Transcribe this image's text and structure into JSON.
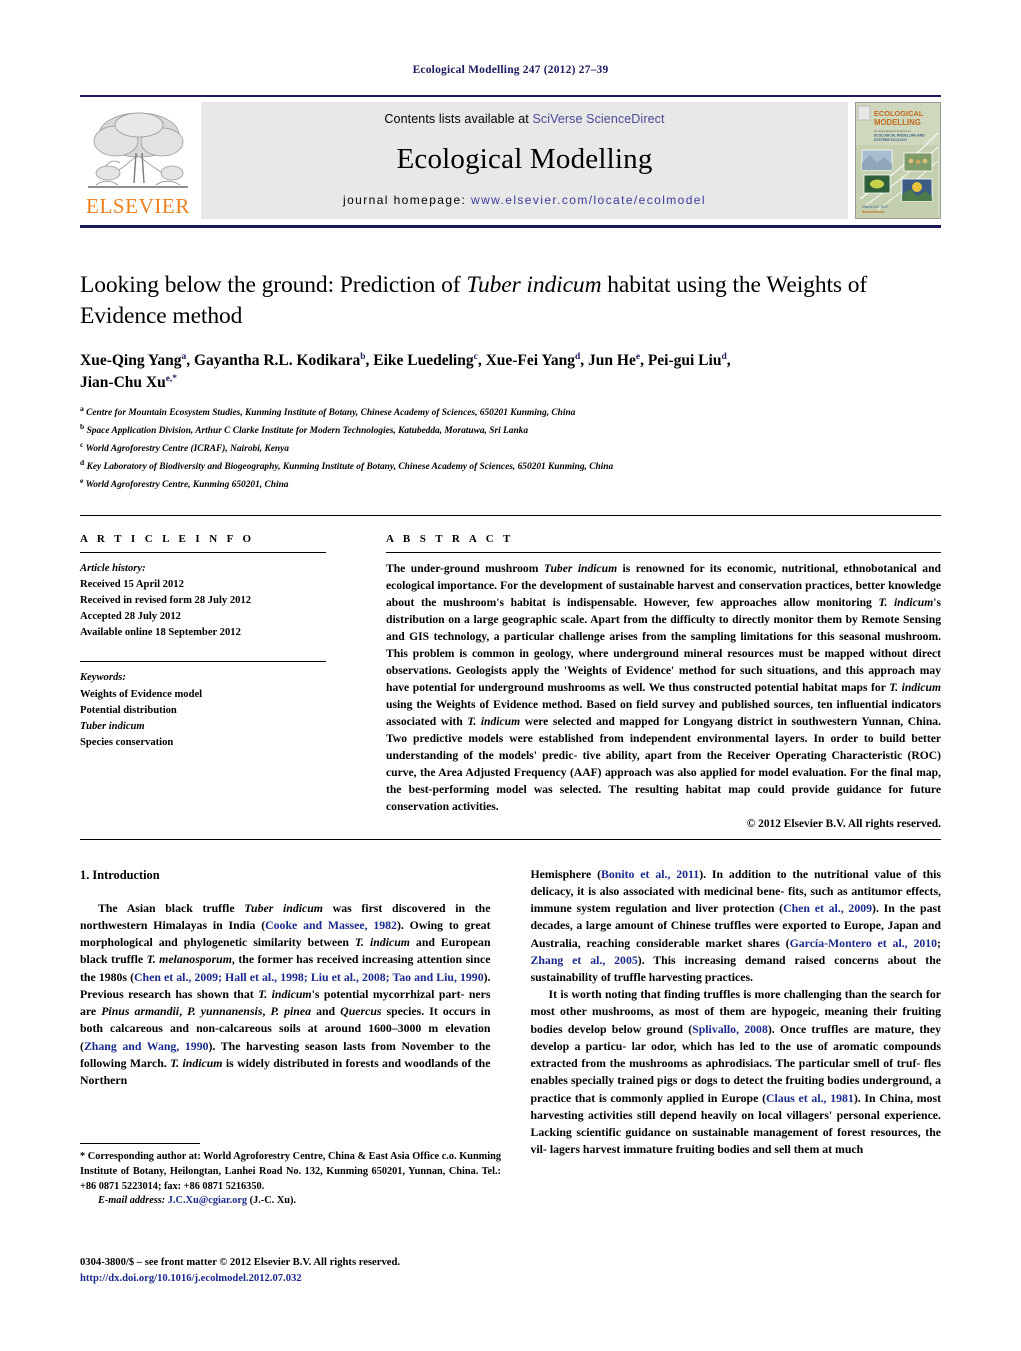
{
  "running_head": "Ecological Modelling 247 (2012) 27–39",
  "masthead": {
    "publisher_wordmark": "ELSEVIER",
    "contents_prefix": "Contents lists available at ",
    "contents_link": "SciVerse ScienceDirect",
    "journal_name": "Ecological Modelling",
    "homepage_label": "journal homepage: ",
    "homepage_url": "www.elsevier.com/locate/ecolmodel",
    "cover_title_line1": "ECOLOGICAL",
    "cover_title_line2": "MODELLING",
    "cover_subtitle": "An International Journal on Ecological Modelling and Systems Ecology"
  },
  "article": {
    "title_part1": "Looking below the ground: Prediction of ",
    "title_italic": "Tuber indicum",
    "title_part2": " habitat using the Weights of Evidence method",
    "authors": [
      {
        "name": "Xue-Qing Yang",
        "sup": "a",
        "sep": ", "
      },
      {
        "name": "Gayantha R.L. Kodikara",
        "sup": "b",
        "sep": ", "
      },
      {
        "name": "Eike Luedeling",
        "sup": "c",
        "sep": ", "
      },
      {
        "name": "Xue-Fei Yang",
        "sup": "d",
        "sep": ", "
      },
      {
        "name": "Jun He",
        "sup": "e",
        "sep": ", "
      },
      {
        "name": "Pei-gui Liu",
        "sup": "d",
        "sep": ", "
      },
      {
        "name": "Jian-Chu Xu",
        "sup": "e,*",
        "sep": ""
      }
    ],
    "affiliations": [
      {
        "mark": "a",
        "text": "Centre for Mountain Ecosystem Studies, Kunming Institute of Botany, Chinese Academy of Sciences, 650201 Kunming, China"
      },
      {
        "mark": "b",
        "text": "Space Application Division, Arthur C Clarke Institute for Modern Technologies, Katubedda, Moratuwa, Sri Lanka"
      },
      {
        "mark": "c",
        "text": "World Agroforestry Centre (ICRAF), Nairobi, Kenya"
      },
      {
        "mark": "d",
        "text": "Key Laboratory of Biodiversity and Biogeography, Kunming Institute of Botany, Chinese Academy of Sciences, 650201 Kunming, China"
      },
      {
        "mark": "e",
        "text": "World Agroforestry Centre, Kunming 650201, China"
      }
    ]
  },
  "article_info": {
    "heading": "A R T I C L E   I N F O",
    "history_label": "Article history:",
    "history": [
      "Received 15 April 2012",
      "Received in revised form 28 July 2012",
      "Accepted 28 July 2012",
      "Available online 18 September 2012"
    ],
    "keywords_label": "Keywords:",
    "keywords": [
      "Weights of Evidence model",
      "Potential distribution",
      "Tuber indicum",
      "Species conservation"
    ]
  },
  "abstract": {
    "heading": "A B S T R A C T",
    "copyright": "© 2012 Elsevier B.V. All rights reserved."
  },
  "introduction": {
    "heading": "1.  Introduction"
  },
  "footnote": {
    "corresponding": "* Corresponding author at: World Agroforestry Centre, China & East Asia Office c.o. Kunming Institute of Botany, Heilongtan, Lanhei Road No. 132, Kunming 650201, Yunnan, China. Tel.: +86 0871 5223014; fax: +86 0871 5216350.",
    "email_label": "E-mail address:",
    "email": "J.C.Xu@cgiar.org",
    "email_attrib": "(J.-C. Xu)."
  },
  "frontmatter": {
    "line": "0304-3800/$ – see front matter © 2012 Elsevier B.V. All rights reserved.",
    "doi": "http://dx.doi.org/10.1016/j.ecolmodel.2012.07.032"
  },
  "colors": {
    "navy": "#1a1a5e",
    "orange": "#ef7f1a",
    "link": "#1a2a8c",
    "band": "#e8e8e8"
  }
}
